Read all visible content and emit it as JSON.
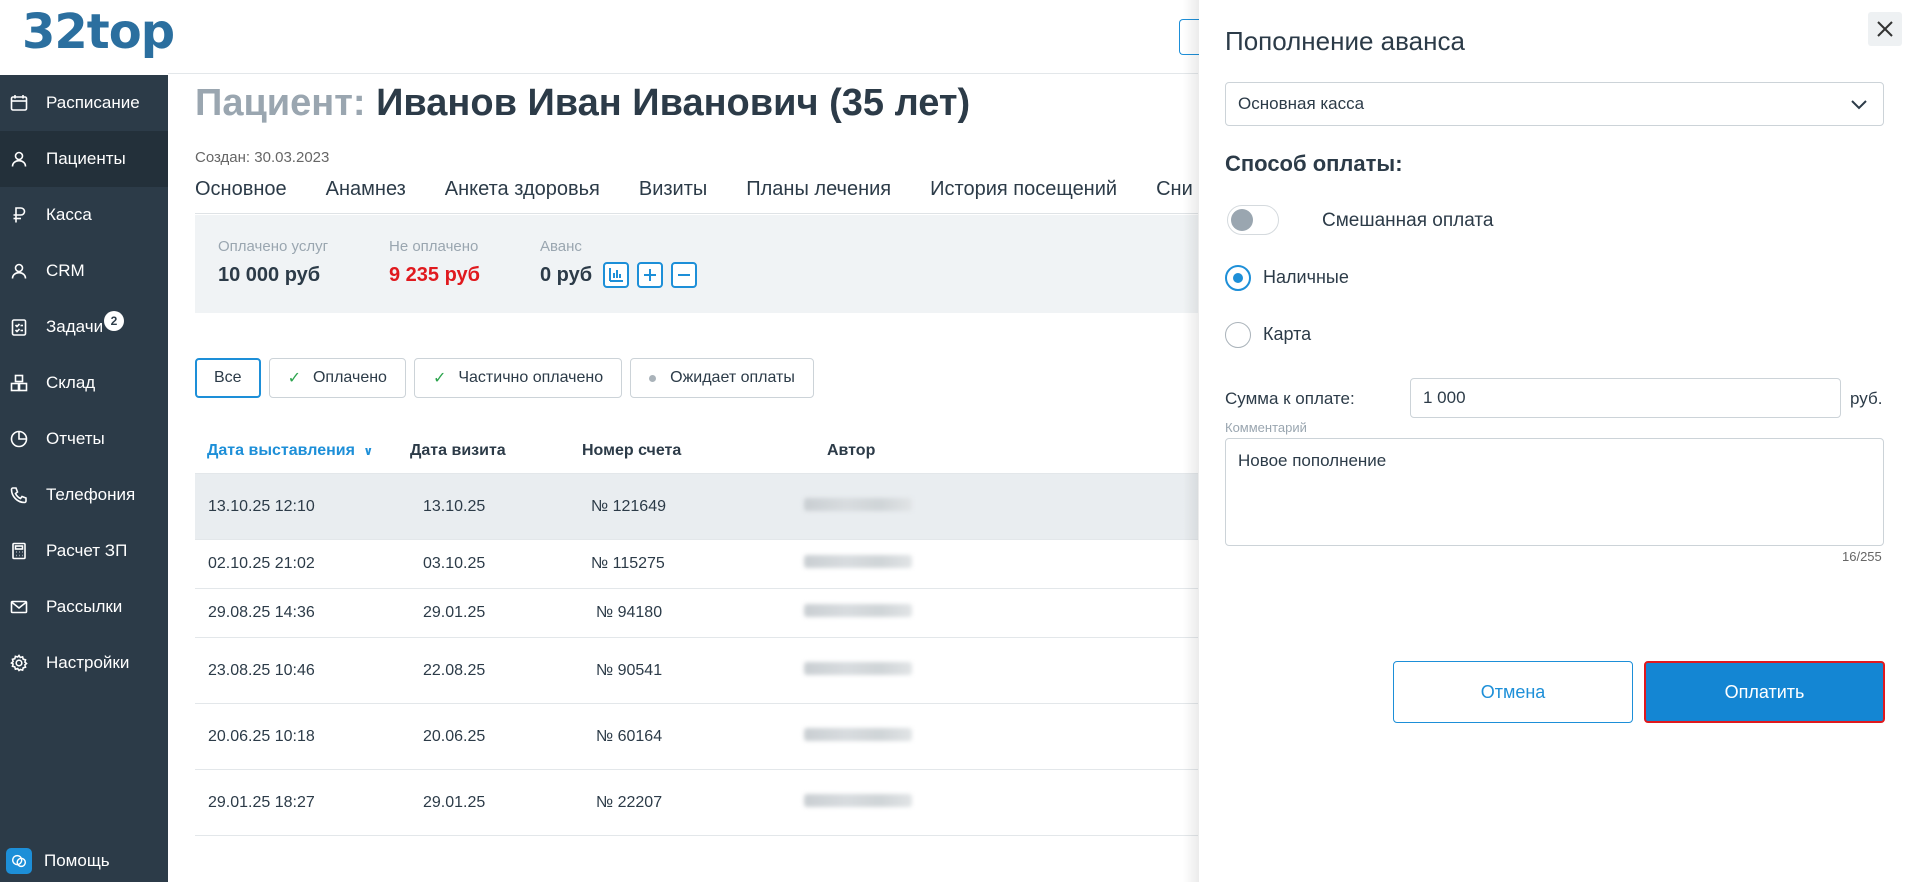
{
  "app": {
    "logo": "32top"
  },
  "sidebar": {
    "items": [
      {
        "label": "Расписание",
        "icon": "calendar-icon"
      },
      {
        "label": "Пациенты",
        "icon": "user-icon"
      },
      {
        "label": "Касса",
        "icon": "ruble-icon"
      },
      {
        "label": "CRM",
        "icon": "user-icon"
      },
      {
        "label": "Задачи",
        "icon": "clipboard-icon",
        "badge": "2"
      },
      {
        "label": "Склад",
        "icon": "boxes-icon"
      },
      {
        "label": "Отчеты",
        "icon": "pie-chart-icon"
      },
      {
        "label": "Телефония",
        "icon": "phone-icon"
      },
      {
        "label": "Расчет ЗП",
        "icon": "calculator-icon"
      },
      {
        "label": "Рассылки",
        "icon": "mail-icon"
      },
      {
        "label": "Настройки",
        "icon": "gear-icon"
      }
    ],
    "active": "Пациенты",
    "help": "Помощь"
  },
  "patient": {
    "title_label": "Пациент:",
    "title_name": "Иванов Иван Иванович (35 лет)",
    "created": "Создан: 30.03.2023",
    "tabs": [
      "Основное",
      "Анамнез",
      "Анкета здоровья",
      "Визиты",
      "Планы лечения",
      "История посещений",
      "Сни"
    ]
  },
  "summary": {
    "paid_label": "Оплачено услуг",
    "paid_value": "10 000 руб",
    "unpaid_label": "Не оплачено",
    "unpaid_value": "9 235 руб",
    "advance_label": "Аванс",
    "advance_value": "0 руб"
  },
  "filters": [
    "Все",
    "Оплачено",
    "Частично оплачено",
    "Ожидает оплаты"
  ],
  "table": {
    "headers": [
      "Дата выставления",
      "Дата визита",
      "Номер счета",
      "Автор"
    ],
    "rows": [
      {
        "issued": "13.10.25 12:10",
        "visit": "13.10.25",
        "number": "№ 121649"
      },
      {
        "issued": "02.10.25 21:02",
        "visit": "03.10.25",
        "number": "№ 115275"
      },
      {
        "issued": "29.08.25 14:36",
        "visit": "29.01.25",
        "number": "№ 94180"
      },
      {
        "issued": "23.08.25 10:46",
        "visit": "22.08.25",
        "number": "№ 90541"
      },
      {
        "issued": "20.06.25 10:18",
        "visit": "20.06.25",
        "number": "№ 60164"
      },
      {
        "issued": "29.01.25 18:27",
        "visit": "29.01.25",
        "number": "№ 22207"
      }
    ]
  },
  "panel": {
    "title": "Пополнение аванса",
    "cashbox": "Основная касса",
    "payment_method_label": "Способ оплаты:",
    "mixed_label": "Смешанная оплата",
    "mixed_on": false,
    "cash_label": "Наличные",
    "card_label": "Карта",
    "selected_method": "Наличные",
    "amount_label": "Сумма к оплате:",
    "amount_value": "1 000",
    "currency": "руб.",
    "comment_label": "Комментарий",
    "comment_value": "Новое пополнение",
    "counter": "16/255",
    "cancel_label": "Отмена",
    "pay_label": "Оплатить"
  },
  "colors": {
    "accent": "#1d8fd8",
    "sidebar": "#2c3b48",
    "danger": "#e0191e",
    "success": "#2da44e"
  }
}
